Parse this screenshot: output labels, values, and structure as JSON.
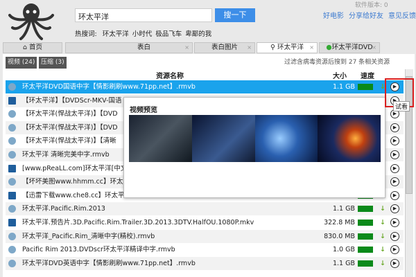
{
  "header": {
    "version": "软件版本: 0",
    "search_value": "环太平洋",
    "search_button": "搜一下",
    "links": [
      "好电影",
      "分享给好友",
      "意见反馈"
    ],
    "hot_label": "热搜词:",
    "hot_words": [
      "环太平洋",
      "小时代",
      "极品飞车",
      "卑鄙的我"
    ]
  },
  "tabs": [
    {
      "label": "首页",
      "icon": "home-icon"
    },
    {
      "label": "表白"
    },
    {
      "label": "表白图片"
    },
    {
      "label": "环太平洋",
      "icon": "search-icon"
    },
    {
      "label": "环太平洋DVD",
      "icon": "green-dot-icon"
    }
  ],
  "filters": [
    "视频 (24)",
    "压缩 (3)"
  ],
  "found_text": "过滤含病毒资源后搜到 27 条相关资源",
  "columns": {
    "name": "资源名称",
    "size": "大小",
    "speed": "速度"
  },
  "rows": [
    {
      "icon": "bubble",
      "name": "环太平洋DVD国语中字【情影刷刷www.71pp.net】.rmvb",
      "size": "1.1 GB",
      "selected": true
    },
    {
      "icon": "ship",
      "name": "【环太平洋】【DVDScr-MKV-国语",
      "size": ""
    },
    {
      "icon": "bubble",
      "name": "【环太平洋(悍战太平洋)】【DVD",
      "size": ""
    },
    {
      "icon": "bubble",
      "name": "【环太平洋(悍战太平洋)】【DVD",
      "size": ""
    },
    {
      "icon": "bubble",
      "name": "【环太平洋(悍战太平洋)】【清晰",
      "size": ""
    },
    {
      "icon": "bubble",
      "name": "环太平洋 清晰完美中字.rmvb",
      "size": ""
    },
    {
      "icon": "ship",
      "name": "[www.pReaLL.com]环太平洋[中文字",
      "size": ""
    },
    {
      "icon": "bubble",
      "name": "【坏坏美图www.hhmm.cc】环太平",
      "size": ""
    },
    {
      "icon": "ship",
      "name": "【迅雷下载www.che8.cc】环太平洋.TC清晰国英双语中字.mkv",
      "size": "1.5 GB"
    },
    {
      "icon": "bubble",
      "name": "环太平洋.Pacific.Rim.2013",
      "size": "1.1 GB"
    },
    {
      "icon": "ship",
      "name": "环太平洋.预告片.3D.Pacific.Rim.Trailer.3D.2013.3DTV.HalfOU.1080P.mkv",
      "size": "322.8 MB"
    },
    {
      "icon": "bubble",
      "name": "环太平洋_Pacific.Rim_清晰中字(精校).rmvb",
      "size": "830.0 MB"
    },
    {
      "icon": "bubble",
      "name": "Pacific Rim 2013.DVDscr环太平洋精译中字.rmvb",
      "size": "1.0 GB"
    },
    {
      "icon": "bubble",
      "name": "环太平洋DVD英语中字【情影刷刷www.71pp.net】.rmvb",
      "size": "1.1 GB"
    }
  ],
  "popup": {
    "title": "视频预览"
  },
  "tooltip": "试看",
  "colors": {
    "accent": "#1aa3ec",
    "button": "#3d8ee8",
    "speed": "#0a8a1a",
    "highlight": "#d92020"
  }
}
